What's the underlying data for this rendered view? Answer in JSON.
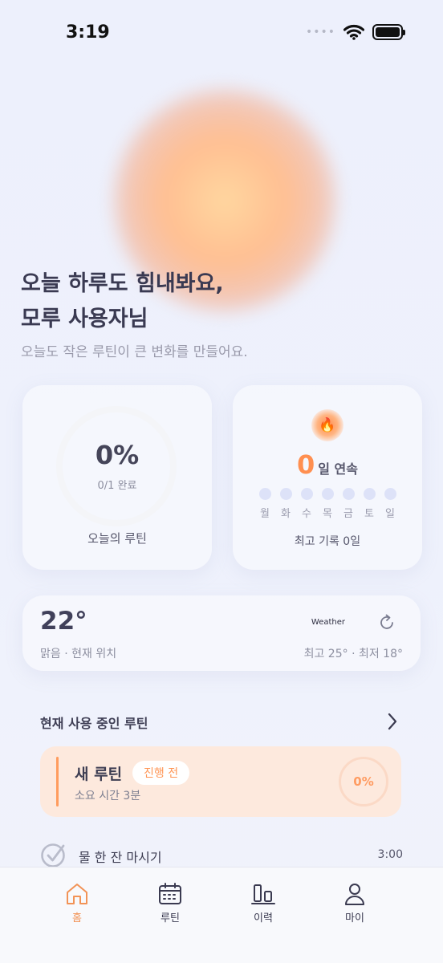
{
  "status_bar": {
    "time": "3:19",
    "dots": "••••"
  },
  "hero": {
    "greeting_line1": "오늘 하루도 힘내봐요,",
    "greeting_line2": "모루 사용자님",
    "subtitle": "오늘도 작은 루틴이 큰 변화를 만들어요."
  },
  "progress": {
    "percent": "0%",
    "done": "0/1 완료",
    "label": "오늘의 루틴",
    "value": 0
  },
  "streak": {
    "flame_glyph": "🔥",
    "count": "0",
    "unit": "일 연속",
    "days": [
      "월",
      "화",
      "수",
      "목",
      "금",
      "토",
      "일"
    ],
    "best": "최고 기록 0일"
  },
  "weather": {
    "temperature": "22°",
    "condition": "맑음 · 현재 위치",
    "brand": "Weather",
    "brand_logo": "",
    "hilo": "최고 25° · 최저 18°"
  },
  "section": {
    "title": "현재 사용 중인 루틴"
  },
  "routine": {
    "name": "새 루틴",
    "status": "진행 전",
    "duration": "소요 시간 3분",
    "progress": "0%",
    "accent_color": "#ff9c5e"
  },
  "task": {
    "name": "물 한 잔 마시기",
    "time": "3:00"
  },
  "tabs": [
    {
      "label": "홈",
      "icon": "home-icon",
      "active": true
    },
    {
      "label": "루틴",
      "icon": "calendar-icon",
      "active": false
    },
    {
      "label": "이력",
      "icon": "bar-chart-icon",
      "active": false
    },
    {
      "label": "마이",
      "icon": "person-icon",
      "active": false
    }
  ],
  "colors": {
    "accent": "#f29356",
    "background": "#eef1fc",
    "routine_card": "#fde9dd"
  }
}
